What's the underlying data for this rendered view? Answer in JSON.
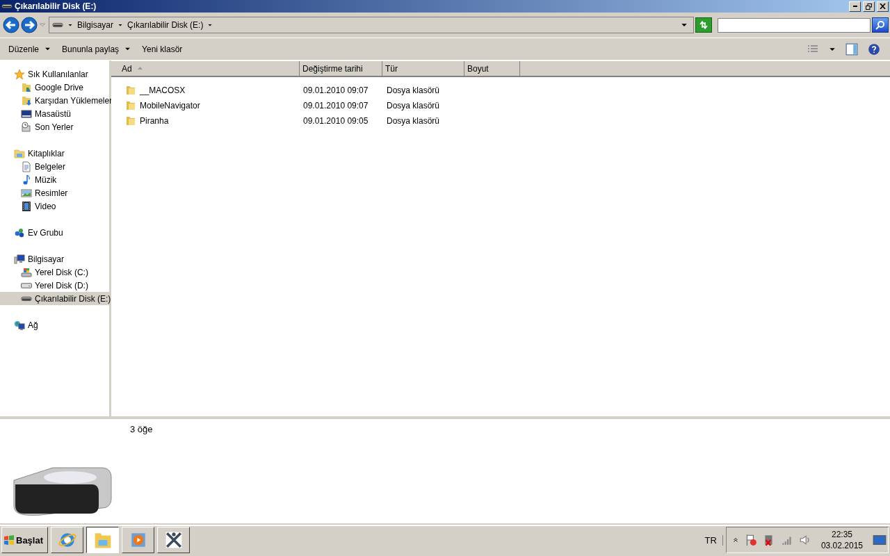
{
  "window": {
    "title": "Çıkarılabilir Disk (E:)"
  },
  "address_bar": {
    "crumbs": [
      "Bilgisayar",
      "Çıkarılabilir Disk (E:)"
    ]
  },
  "toolbar": {
    "buttons": [
      {
        "label": "Düzenle",
        "dropdown": true
      },
      {
        "label": "Bununla paylaş",
        "dropdown": true
      },
      {
        "label": "Yeni klasör",
        "dropdown": false
      }
    ]
  },
  "sidebar": {
    "groups": [
      {
        "label": "Sık Kullanılanlar",
        "selected": false,
        "children": [
          {
            "label": "Google Drive",
            "selected": false
          },
          {
            "label": "Karşıdan Yüklemeler",
            "selected": false
          },
          {
            "label": "Masaüstü",
            "selected": false
          },
          {
            "label": "Son Yerler",
            "selected": false
          }
        ]
      },
      {
        "label": "Kitaplıklar",
        "selected": false,
        "children": [
          {
            "label": "Belgeler",
            "selected": false
          },
          {
            "label": "Müzik",
            "selected": false
          },
          {
            "label": "Resimler",
            "selected": false
          },
          {
            "label": "Video",
            "selected": false
          }
        ]
      },
      {
        "label": "Ev Grubu",
        "selected": false
      },
      {
        "label": "Bilgisayar",
        "selected": false,
        "children": [
          {
            "label": "Yerel Disk (C:)",
            "selected": false
          },
          {
            "label": "Yerel Disk (D:)",
            "selected": false
          },
          {
            "label": "Çıkarılabilir Disk (E:)",
            "selected": true
          }
        ]
      },
      {
        "label": "Ağ",
        "selected": false
      }
    ]
  },
  "table": {
    "columns": [
      {
        "label": "Ad",
        "sorted": true
      },
      {
        "label": "Değiştirme tarihi",
        "sorted": false
      },
      {
        "label": "Tür",
        "sorted": false
      },
      {
        "label": "Boyut",
        "sorted": false
      }
    ],
    "rows": [
      {
        "name": "__MACOSX",
        "date": "09.01.2010 09:07",
        "type": "Dosya klasörü"
      },
      {
        "name": "MobileNavigator",
        "date": "09.01.2010 09:07",
        "type": "Dosya klasörü"
      },
      {
        "name": "Piranha",
        "date": "09.01.2010 09:05",
        "type": "Dosya klasörü"
      }
    ]
  },
  "details": {
    "count": "3 öğe"
  },
  "taskbar": {
    "start": "Başlat",
    "tasks": [
      {
        "active": false
      },
      {
        "active": true
      },
      {
        "active": false
      },
      {
        "active": false
      }
    ],
    "language": "TR",
    "time": "22:35",
    "date": "03.02.2015"
  }
}
